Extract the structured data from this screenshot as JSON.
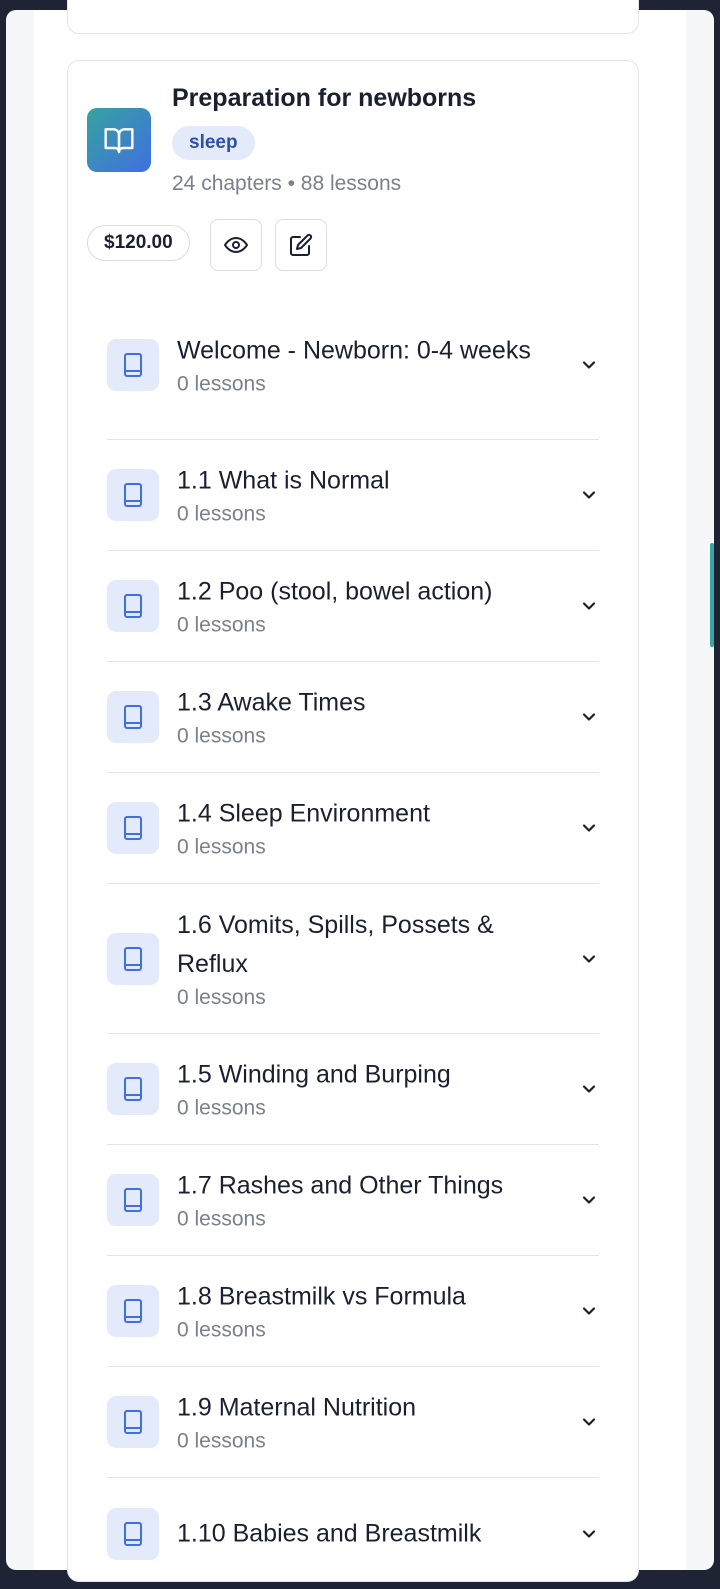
{
  "course": {
    "title": "Preparation for newborns",
    "tag": "sleep",
    "meta": "24 chapters • 88 lessons",
    "price": "$120.00",
    "icon": "open-book-icon",
    "actions": [
      {
        "name": "view-button",
        "icon": "eye-icon"
      },
      {
        "name": "edit-button",
        "icon": "edit-icon"
      }
    ]
  },
  "chapters": [
    {
      "title": "Welcome - Newborn: 0-4 weeks",
      "lessons": "0 lessons"
    },
    {
      "title": "1.1 What is Normal",
      "lessons": "0 lessons"
    },
    {
      "title": "1.2 Poo (stool, bowel action)",
      "lessons": "0 lessons"
    },
    {
      "title": "1.3 Awake Times",
      "lessons": "0 lessons"
    },
    {
      "title": "1.4 Sleep Environment",
      "lessons": "0 lessons"
    },
    {
      "title": "1.6 Vomits, Spills, Possets & Reflux",
      "lessons": "0 lessons"
    },
    {
      "title": "1.5 Winding and Burping",
      "lessons": "0 lessons"
    },
    {
      "title": "1.7 Rashes and Other Things",
      "lessons": "0 lessons"
    },
    {
      "title": "1.8 Breastmilk vs Formula",
      "lessons": "0 lessons"
    },
    {
      "title": "1.9 Maternal Nutrition",
      "lessons": "0 lessons"
    },
    {
      "title": "1.10 Babies and Breastmilk",
      "lessons": ""
    }
  ],
  "colors": {
    "accent": "#3f6fe0",
    "tag_bg": "#e3ebfb",
    "tag_text": "#2f4ea8",
    "chapter_icon": "book-icon"
  }
}
